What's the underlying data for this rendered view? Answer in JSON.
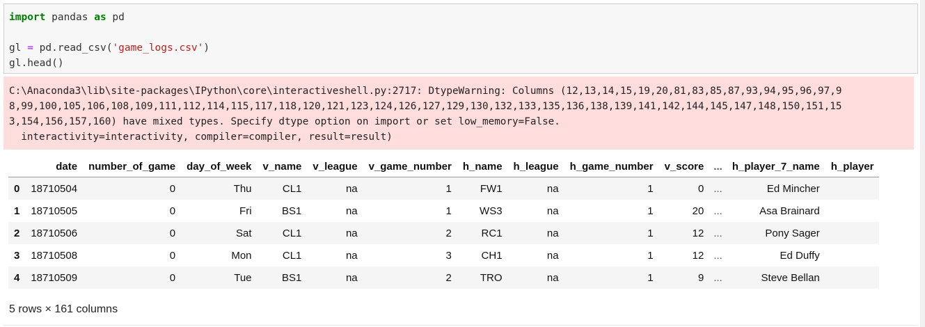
{
  "code_cell": {
    "line1": {
      "kw1": "import",
      "mid": " pandas ",
      "kw2": "as",
      "end": " pd"
    },
    "line3": {
      "var": "gl",
      "eq": " = ",
      "call": "pd.read_csv(",
      "str": "'game_logs.csv'",
      "close": ")"
    },
    "line4": {
      "head": "gl.head",
      "parens": "()"
    }
  },
  "warning": {
    "lines": [
      "C:\\Anaconda3\\lib\\site-packages\\IPython\\core\\interactiveshell.py:2717: DtypeWarning: Columns (12,13,14,15,19,20,81,83,85,87,93,94,95,96,97,9",
      "8,99,100,105,106,108,109,111,112,114,115,117,118,120,121,123,124,126,127,129,130,132,133,135,136,138,139,141,142,144,145,147,148,150,151,15",
      "3,154,156,157,160) have mixed types. Specify dtype option on import or set low_memory=False.",
      "  interactivity=interactivity, compiler=compiler, result=result)"
    ]
  },
  "dataframe": {
    "columns": [
      "",
      "date",
      "number_of_game",
      "day_of_week",
      "v_name",
      "v_league",
      "v_game_number",
      "h_name",
      "h_league",
      "h_game_number",
      "v_score",
      "...",
      "h_player_7_name",
      "h_player"
    ],
    "rows": [
      [
        "0",
        "18710504",
        "0",
        "Thu",
        "CL1",
        "na",
        "1",
        "FW1",
        "na",
        "1",
        "0",
        "...",
        "Ed Mincher",
        ""
      ],
      [
        "1",
        "18710505",
        "0",
        "Fri",
        "BS1",
        "na",
        "1",
        "WS3",
        "na",
        "1",
        "20",
        "...",
        "Asa Brainard",
        ""
      ],
      [
        "2",
        "18710506",
        "0",
        "Sat",
        "CL1",
        "na",
        "2",
        "RC1",
        "na",
        "1",
        "12",
        "...",
        "Pony Sager",
        ""
      ],
      [
        "3",
        "18710508",
        "0",
        "Mon",
        "CL1",
        "na",
        "3",
        "CH1",
        "na",
        "1",
        "12",
        "...",
        "Ed Duffy",
        ""
      ],
      [
        "4",
        "18710509",
        "0",
        "Tue",
        "BS1",
        "na",
        "2",
        "TRO",
        "na",
        "1",
        "9",
        "...",
        "Steve Bellan",
        ""
      ]
    ]
  },
  "footer": "5 rows × 161 columns"
}
